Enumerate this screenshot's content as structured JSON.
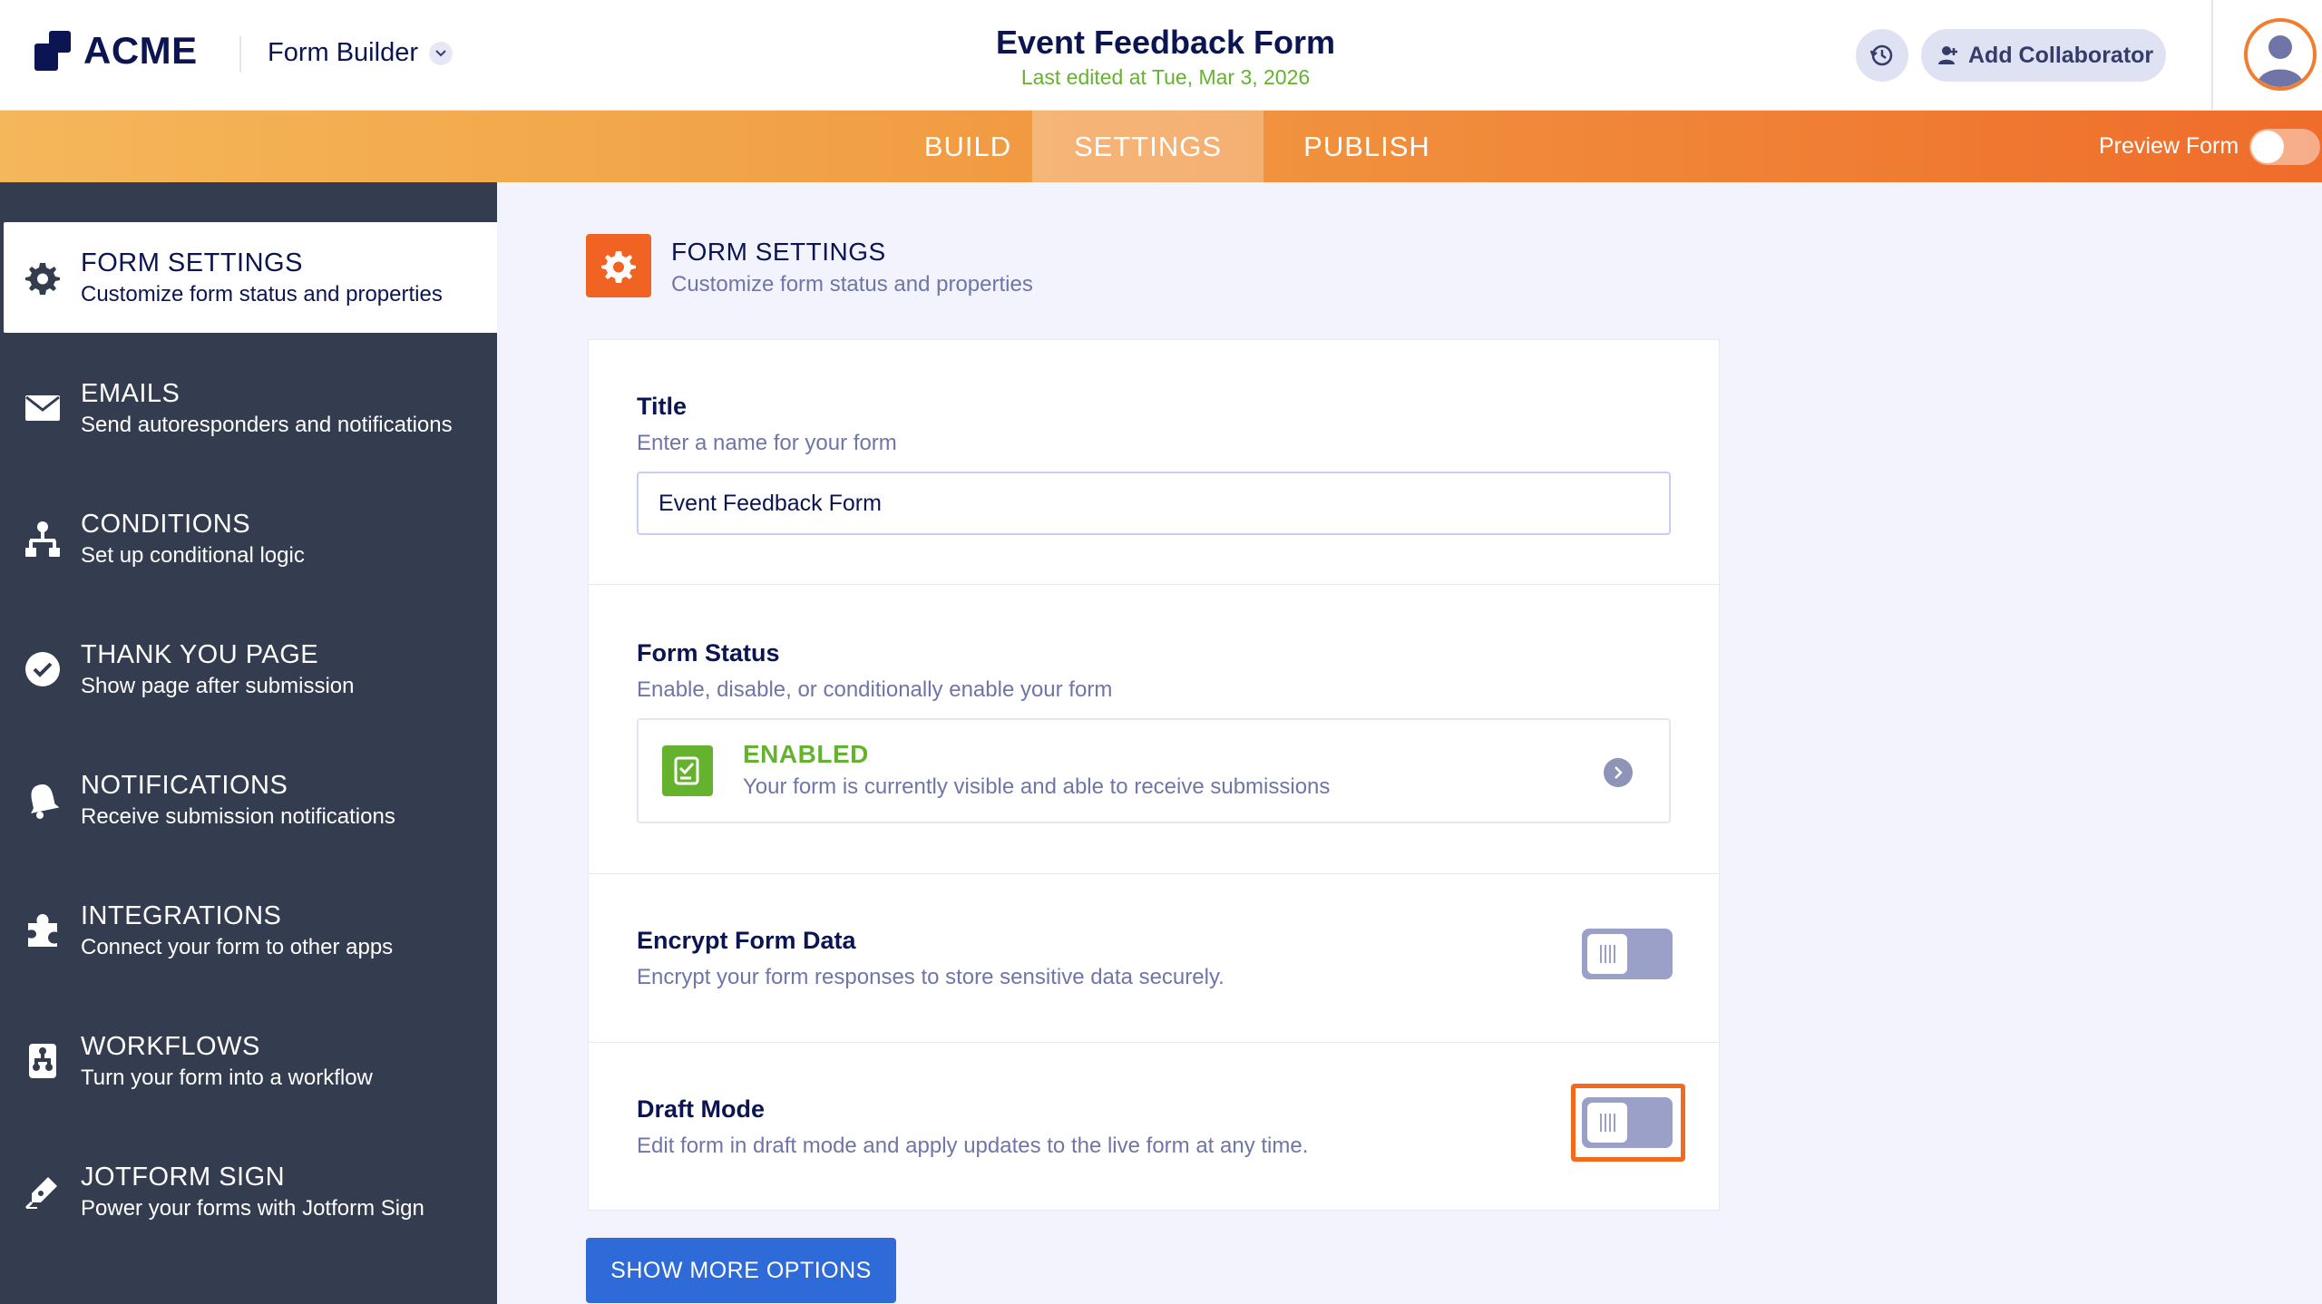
{
  "header": {
    "logo_text": "ACME",
    "app_name": "Form Builder",
    "form_title": "Event Feedback Form",
    "last_edited": "Last edited at Tue, Mar 3, 2026",
    "collaborator_label": "Add Collaborator"
  },
  "tabs": [
    {
      "label": "BUILD",
      "active": false
    },
    {
      "label": "SETTINGS",
      "active": true
    },
    {
      "label": "PUBLISH",
      "active": false
    }
  ],
  "preview": {
    "label": "Preview Form",
    "enabled": false
  },
  "sidebar": {
    "items": [
      {
        "title": "FORM SETTINGS",
        "desc": "Customize form status and properties",
        "icon": "gear-icon",
        "active": true
      },
      {
        "title": "EMAILS",
        "desc": "Send autoresponders and notifications",
        "icon": "envelope-icon",
        "active": false
      },
      {
        "title": "CONDITIONS",
        "desc": "Set up conditional logic",
        "icon": "hierarchy-icon",
        "active": false
      },
      {
        "title": "THANK YOU PAGE",
        "desc": "Show page after submission",
        "icon": "check-circle-icon",
        "active": false
      },
      {
        "title": "NOTIFICATIONS",
        "desc": "Receive submission notifications",
        "icon": "bell-icon",
        "active": false
      },
      {
        "title": "INTEGRATIONS",
        "desc": "Connect your form to other apps",
        "icon": "puzzle-icon",
        "active": false
      },
      {
        "title": "WORKFLOWS",
        "desc": "Turn your form into a workflow",
        "icon": "workflow-icon",
        "active": false
      },
      {
        "title": "JOTFORM SIGN",
        "desc": "Power your forms with Jotform Sign",
        "icon": "pen-icon",
        "active": false
      }
    ]
  },
  "section": {
    "title": "FORM SETTINGS",
    "desc": "Customize form status and properties"
  },
  "title_field": {
    "label": "Title",
    "desc": "Enter a name for your form",
    "value": "Event Feedback Form"
  },
  "form_status": {
    "label": "Form Status",
    "desc": "Enable, disable, or conditionally enable your form",
    "status": "ENABLED",
    "status_desc": "Your form is currently visible and able to receive submissions"
  },
  "encrypt": {
    "label": "Encrypt Form Data",
    "desc": "Encrypt your form responses to store sensitive data securely.",
    "enabled": false
  },
  "draft": {
    "label": "Draft Mode",
    "desc": "Edit form in draft mode and apply updates to the live form at any time.",
    "enabled": false
  },
  "more_button": "SHOW MORE OPTIONS",
  "colors": {
    "accent": "#f06322",
    "navy": "#0a1551",
    "enabled_green": "#64b22e",
    "sidebar_bg": "#343c4f",
    "primary_button": "#2f6bd8"
  }
}
